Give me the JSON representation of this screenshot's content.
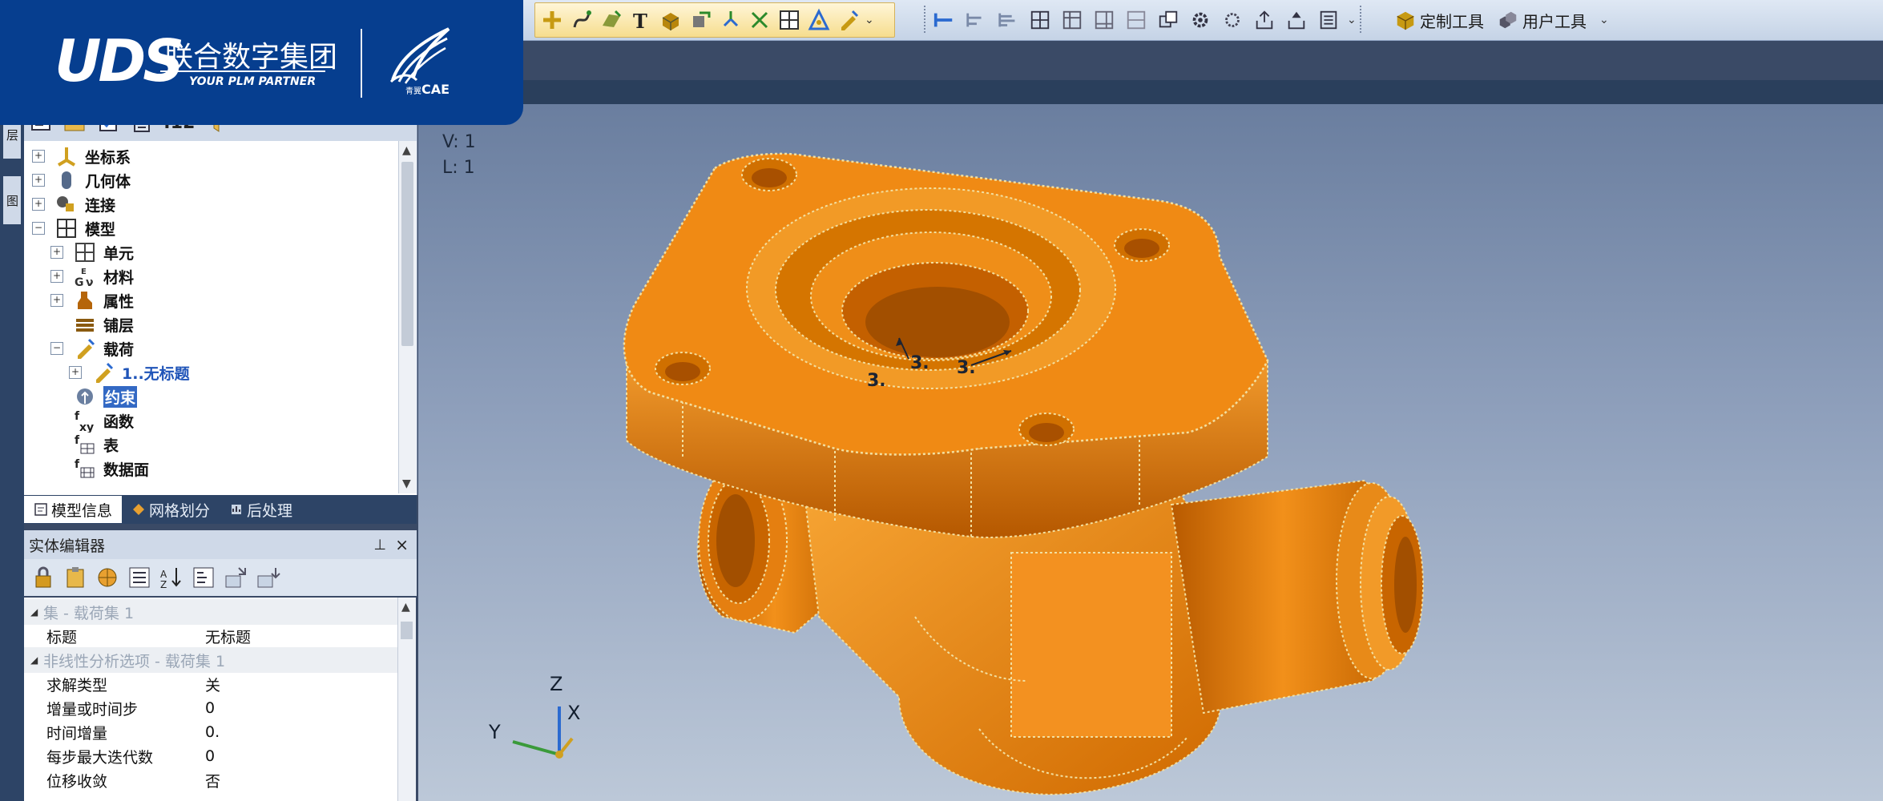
{
  "brand": {
    "logo_text": "UDS",
    "company_cn": "联合数字集团",
    "tagline": "YOUR PLM PARTNER",
    "sub_logo": "CAE",
    "sub_logo_small": "青翼",
    "color": "#063e8f"
  },
  "toolbar": {
    "custom_tools": "定制工具",
    "user_tools": "用户工具",
    "overflow": "⌄",
    "icons": [
      "add-icon",
      "curve-icon",
      "surface-icon",
      "text-icon",
      "solid-icon",
      "mesh-icon",
      "node-icon",
      "element-icon",
      "grid-icon",
      "triangle-icon",
      "pen-icon"
    ],
    "view_icons": [
      "measure-icon",
      "align-icon",
      "align2-icon",
      "table-icon",
      "table2-icon",
      "table3-icon",
      "table4-icon",
      "copy-icon",
      "gear-icon",
      "gear2-icon",
      "export-icon",
      "import-icon",
      "list-icon"
    ]
  },
  "tree": {
    "toolbar_number": ":12",
    "items": [
      {
        "label": "坐标系",
        "icon": "coordinate-icon",
        "indent": 0,
        "expander": "+"
      },
      {
        "label": "几何体",
        "icon": "geometry-icon",
        "indent": 0,
        "expander": "+"
      },
      {
        "label": "连接",
        "icon": "connection-icon",
        "indent": 0,
        "expander": "+"
      },
      {
        "label": "模型",
        "icon": "model-icon",
        "indent": 0,
        "expander": "−"
      },
      {
        "label": "单元",
        "icon": "element-icon",
        "indent": 1,
        "expander": "+"
      },
      {
        "label": "材料",
        "icon": "material-icon",
        "indent": 1,
        "expander": "+"
      },
      {
        "label": "属性",
        "icon": "property-icon",
        "indent": 1,
        "expander": "+"
      },
      {
        "label": "铺层",
        "icon": "layup-icon",
        "indent": 1,
        "expander": ""
      },
      {
        "label": "载荷",
        "icon": "load-icon",
        "indent": 1,
        "expander": "−"
      },
      {
        "label": "1..无标题",
        "icon": "load-set-icon",
        "indent": 2,
        "expander": "+"
      },
      {
        "label": "约束",
        "icon": "constraint-icon",
        "indent": 1,
        "expander": ""
      },
      {
        "label": "函数",
        "icon": "function-icon",
        "indent": 1,
        "expander": ""
      },
      {
        "label": "表",
        "icon": "table-icon",
        "indent": 1,
        "expander": ""
      },
      {
        "label": "数据面",
        "icon": "data-surface-icon",
        "indent": 1,
        "expander": ""
      }
    ],
    "tabs": [
      {
        "label": "模型信息",
        "icon": "model-info-icon"
      },
      {
        "label": "网格划分",
        "icon": "mesh-icon"
      },
      {
        "label": "后处理",
        "icon": "post-icon"
      }
    ]
  },
  "side_tabs": [
    "层",
    "图"
  ],
  "editor": {
    "title": "实体编辑器",
    "pin": "ᅟ⊥",
    "close": "×",
    "rows": [
      {
        "type": "cat",
        "key": "集 - 载荷集 1"
      },
      {
        "type": "prop",
        "key": "标题",
        "value": "无标题"
      },
      {
        "type": "cat",
        "key": "非线性分析选项 - 载荷集 1"
      },
      {
        "type": "prop",
        "key": "求解类型",
        "value": "关"
      },
      {
        "type": "prop",
        "key": "增量或时间步",
        "value": "0"
      },
      {
        "type": "prop",
        "key": "时间增量",
        "value": "0."
      },
      {
        "type": "prop",
        "key": "每步最大迭代数",
        "value": "0"
      },
      {
        "type": "prop",
        "key": "位移收敛",
        "value": "否"
      }
    ]
  },
  "viewport": {
    "view_label": "V: 1",
    "layer_label": "L: 1",
    "load_labels": [
      "3.",
      "3.",
      "3."
    ],
    "part_color": "#f28a12",
    "axes": {
      "z": "Z",
      "x": "X",
      "y": "Y"
    }
  }
}
